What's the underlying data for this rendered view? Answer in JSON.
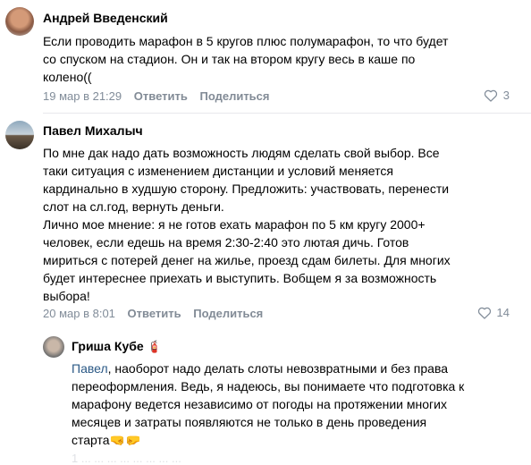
{
  "comments": [
    {
      "author": "Андрей Введенский",
      "text": "Если проводить марафон в 5 кругов плюс полумарафон, то что будет\nсо спуском на стадион. Он и так на втором кругу весь в каше по\nколено((",
      "time": "19 мар в 21:29",
      "reply_label": "Ответить",
      "share_label": "Поделиться",
      "likes": "3"
    },
    {
      "author": "Павел Михалыч",
      "text": "По мне дак надо дать возможность людям сделать свой выбор. Все\nтаки ситуация с изменением дистанции и условий меняется\nкардинально в худшую сторону. Предложить: участвовать, перенести\nслот на сл.год, вернуть деньги.\nЛично мое мнение: я не готов ехать марафон по 5 км кругу 2000+\nчеловек, если едешь на время 2:30-2:40 это лютая дичь. Готов\nмириться с потерей денег на жилье, проезд сдам билеты. Для многих\nбудет интереснее приехать и выступить. Вобщем я за возможность\nвыбора!",
      "time": "20 мар в 8:01",
      "reply_label": "Ответить",
      "share_label": "Поделиться",
      "likes": "14"
    }
  ],
  "reply": {
    "author": "Гриша Кубе",
    "author_badge": "🧯",
    "mention": "Павел",
    "text_start": ", наоборот надо делать слоты невозвратными и без права\nпереоформления. Ведь, я надеюсь, вы понимаете что подготовка к\nмарафону ведется независимо от погоды на протяжении многих\nмесяцев и затраты появляются не только в день проведения\nстарта",
    "emoji": "🤜🤛",
    "meta_partial": "1 ... ... ... ... ... ... ... ..."
  },
  "icons": {
    "like": "heart-outline-icon"
  },
  "colors": {
    "meta": "#818c99",
    "link": "#2a5885",
    "divider": "#e7e8ec"
  }
}
